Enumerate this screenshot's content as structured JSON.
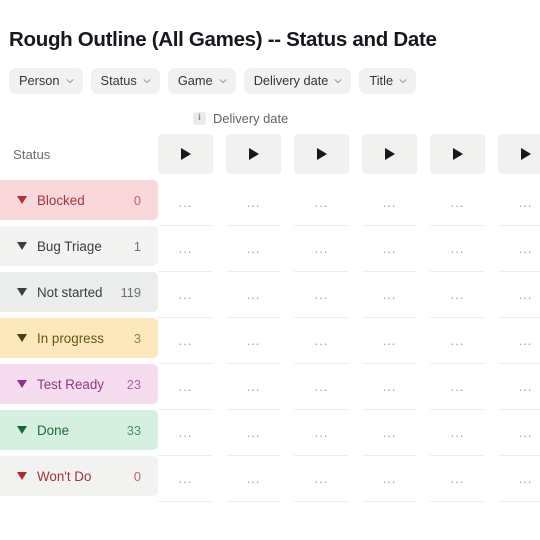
{
  "page": {
    "title": "Rough Outline (All Games) -- Status and Date"
  },
  "filters": {
    "chevron_icon": "chevron-down-icon",
    "items": [
      {
        "label": "Person"
      },
      {
        "label": "Status"
      },
      {
        "label": "Game"
      },
      {
        "label": "Delivery date"
      },
      {
        "label": "Title"
      }
    ]
  },
  "grouping_caption": {
    "info_icon": "info-icon",
    "info_glyph": "i",
    "label": "Delivery date"
  },
  "board": {
    "row_header_label": "Status",
    "cell_placeholder": "...",
    "collapse_icon": "triangle-right-icon",
    "expand_icon": "triangle-down-icon",
    "columns": [
      {
        "name": "column-1"
      },
      {
        "name": "column-2"
      },
      {
        "name": "column-3"
      },
      {
        "name": "column-4"
      },
      {
        "name": "column-5"
      },
      {
        "name": "column-6"
      }
    ],
    "rows": [
      {
        "label": "Blocked",
        "count": "0",
        "bg": "#fad7da",
        "fg": "#a3373f",
        "tri": "#b03038"
      },
      {
        "label": "Bug Triage",
        "count": "1",
        "bg": "#f3f3f2",
        "fg": "#3b3d41",
        "tri": "#3b3d41"
      },
      {
        "label": "Not started",
        "count": "119",
        "bg": "#eceded",
        "fg": "#3b3d41",
        "tri": "#3b3d41"
      },
      {
        "label": "In progress",
        "count": "3",
        "bg": "#fbe8bd",
        "fg": "#6e5414",
        "tri": "#4c3d0d"
      },
      {
        "label": "Test Ready",
        "count": "23",
        "bg": "#f5dcee",
        "fg": "#8e3a86",
        "tri": "#932c8e"
      },
      {
        "label": "Done",
        "count": "33",
        "bg": "#d5f0e0",
        "fg": "#1f6b3c",
        "tri": "#15682f"
      },
      {
        "label": "Won't Do",
        "count": "0",
        "bg": "#f2f2f1",
        "fg": "#a5333a",
        "tri": "#b5272f"
      }
    ]
  }
}
